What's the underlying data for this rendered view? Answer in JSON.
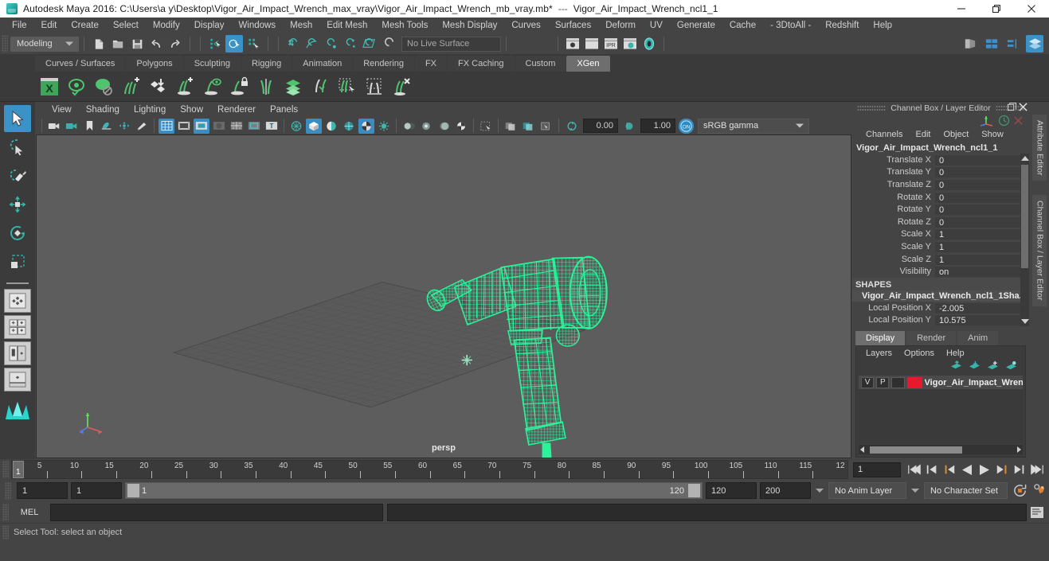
{
  "window": {
    "app_title": "Autodesk Maya 2016: C:\\Users\\a y\\Desktop\\Vigor_Air_Impact_Wrench_max_vray\\Vigor_Air_Impact_Wrench_mb_vray.mb*",
    "separator": "---",
    "sub_title": "Vigor_Air_Impact_Wrench_ncl1_1",
    "minimize_label": "Minimize",
    "restore_label": "Restore",
    "close_label": "Close"
  },
  "menubar": {
    "items": [
      "File",
      "Edit",
      "Create",
      "Select",
      "Modify",
      "Display",
      "Windows",
      "Mesh",
      "Edit Mesh",
      "Mesh Tools",
      "Mesh Display",
      "Curves",
      "Surfaces",
      "Deform",
      "UV",
      "Generate",
      "Cache",
      "- 3DtoAll -",
      "Redshift",
      "Help"
    ]
  },
  "statusline": {
    "mode": "Modeling",
    "live_surface": "No Live Surface",
    "icons": [
      "new-scene-icon",
      "open-scene-icon",
      "save-scene-icon",
      "undo-icon",
      "redo-icon",
      "select-by-hierarchy-icon",
      "select-by-object-icon",
      "select-by-component-icon",
      "snap-to-grid-icon",
      "snap-to-curve-icon",
      "snap-to-point-icon",
      "snap-to-projected-center-icon",
      "snap-to-view-plane-icon",
      "make-live-icon"
    ],
    "render_icons": [
      "render-current-frame-icon",
      "ipr-render-icon",
      "render-settings-icon",
      "render-sequence-icon",
      "hypershade-icon"
    ],
    "right_icons": [
      "show-hide-modeling-toolkit-icon",
      "show-hide-attribute-editor-icon",
      "show-hide-tool-settings-icon",
      "show-hide-channel-box-icon"
    ]
  },
  "shelf": {
    "tabs": [
      "Curves / Surfaces",
      "Polygons",
      "Sculpting",
      "Rigging",
      "Animation",
      "Rendering",
      "FX",
      "FX Caching",
      "Custom",
      "XGen"
    ],
    "active_tab": "XGen",
    "icons": [
      "xgen-editor-icon",
      "xgen-preview-icon",
      "xgen-disable-preview-icon",
      "xgen-add-clumping-icon",
      "xgen-add-noise-icon",
      "xgen-add-description-icon",
      "xgen-preview-description-icon",
      "xgen-lock-description-icon",
      "xgen-part-guides-icon",
      "xgen-layers-icon",
      "xgen-length-icon",
      "xgen-select-guides-icon",
      "xgen-mask-icon",
      "xgen-delete-guides-icon"
    ]
  },
  "toolbox": {
    "tools": [
      {
        "name": "select-tool",
        "label": "Select Tool",
        "selected": true
      },
      {
        "name": "lasso-select-tool",
        "label": "Lasso Select Tool",
        "selected": false
      },
      {
        "name": "paint-select-tool",
        "label": "Paint Select Tool",
        "selected": false
      },
      {
        "name": "move-tool",
        "label": "Move Tool",
        "selected": false
      },
      {
        "name": "rotate-tool",
        "label": "Rotate Tool",
        "selected": false
      },
      {
        "name": "scale-tool",
        "label": "Scale Tool",
        "selected": false
      }
    ],
    "layouts": [
      "single-pane-layout",
      "four-pane-layout",
      "two-pane-side-layout",
      "persp-outliner-layout"
    ]
  },
  "viewport": {
    "menus": [
      "View",
      "Shading",
      "Lighting",
      "Show",
      "Renderer",
      "Panels"
    ],
    "camera_label": "persp",
    "exposure_value": "0.00",
    "gamma_value": "1.00",
    "color_management": "sRGB gamma",
    "toolbar_icons": [
      "select-camera-icon",
      "camera-attributes-icon",
      "bookmark-icon",
      "image-plane-icon",
      "two-d-pan-zoom-icon",
      "grease-pencil-icon",
      "grid-toggle-icon",
      "film-gate-icon",
      "resolution-gate-icon",
      "gate-mask-icon",
      "field-chart-icon",
      "safe-action-icon",
      "safe-title-icon",
      "wireframe-shading-icon",
      "smooth-shade-all-icon",
      "shade-flat-icon",
      "wireframe-on-shaded-icon",
      "textured-icon",
      "use-all-lights-icon",
      "shadows-icon",
      "screen-space-ao-icon",
      "motion-blur-icon",
      "multisample-aa-icon",
      "isolate-select-icon",
      "xray-icon",
      "xray-joints-icon",
      "xray-active-components-icon",
      "exposure-icon",
      "gamma-icon",
      "color-management-toggle-icon"
    ],
    "model_name": "Vigor Air Impact Wrench wireframe",
    "wireframe_color": "#2bf39a",
    "background_color": "#5d5d5d"
  },
  "channel_box": {
    "panel_title": "Channel Box / Layer Editor",
    "menus": [
      "Channels",
      "Edit",
      "Object",
      "Show"
    ],
    "object_name": "Vigor_Air_Impact_Wrench_ncl1_1",
    "transform_channels": [
      {
        "label": "Translate X",
        "value": "0"
      },
      {
        "label": "Translate Y",
        "value": "0"
      },
      {
        "label": "Translate Z",
        "value": "0"
      },
      {
        "label": "Rotate X",
        "value": "0"
      },
      {
        "label": "Rotate Y",
        "value": "0"
      },
      {
        "label": "Rotate Z",
        "value": "0"
      },
      {
        "label": "Scale X",
        "value": "1"
      },
      {
        "label": "Scale Y",
        "value": "1"
      },
      {
        "label": "Scale Z",
        "value": "1"
      },
      {
        "label": "Visibility",
        "value": "on"
      }
    ],
    "shapes_header": "SHAPES",
    "shape_name": "Vigor_Air_Impact_Wrench_ncl1_1Sha...",
    "shape_channels": [
      {
        "label": "Local Position X",
        "value": "-2.005"
      },
      {
        "label": "Local Position Y",
        "value": "10.575"
      }
    ],
    "vertical_tabs": [
      "Attribute Editor",
      "Channel Box / Layer Editor"
    ]
  },
  "layer_editor": {
    "tabs": [
      "Display",
      "Render",
      "Anim"
    ],
    "active_tab": "Display",
    "menus": [
      "Layers",
      "Options",
      "Help"
    ],
    "toolbar_icons": [
      "move-layer-up-icon",
      "move-layer-down-icon",
      "new-layer-icon",
      "new-layer-from-selected-icon"
    ],
    "layers": [
      {
        "visible": "V",
        "playback": "P",
        "type": "",
        "color": "#e8192c",
        "name": "Vigor_Air_Impact_Wrenc"
      }
    ]
  },
  "timeline": {
    "tick_labels": [
      "5",
      "10",
      "15",
      "20",
      "25",
      "30",
      "35",
      "40",
      "45",
      "50",
      "55",
      "60",
      "65",
      "70",
      "75",
      "80",
      "85",
      "90",
      "95",
      "100",
      "105",
      "110",
      "115",
      "12"
    ],
    "current_frame_marker": "1",
    "current_frame_field": "1",
    "playback_buttons": [
      "go-to-start-icon",
      "step-back-keyframe-icon",
      "step-back-frame-icon",
      "play-backwards-icon",
      "play-forwards-icon",
      "step-forward-frame-icon",
      "step-forward-keyframe-icon",
      "go-to-end-icon"
    ]
  },
  "range_slider": {
    "anim_start": "1",
    "range_start": "1",
    "bar_start_label": "1",
    "bar_end_label": "120",
    "range_end": "120",
    "anim_end": "200",
    "anim_layer": "No Anim Layer",
    "character_set": "No Character Set",
    "right_icons": [
      "auto-key-icon",
      "animation-preferences-icon"
    ]
  },
  "command_line": {
    "language_label": "MEL",
    "input_value": "",
    "output_value": "",
    "script_editor_icon": "script-editor-icon"
  },
  "status_bar": {
    "message": "Select Tool: select an object"
  }
}
